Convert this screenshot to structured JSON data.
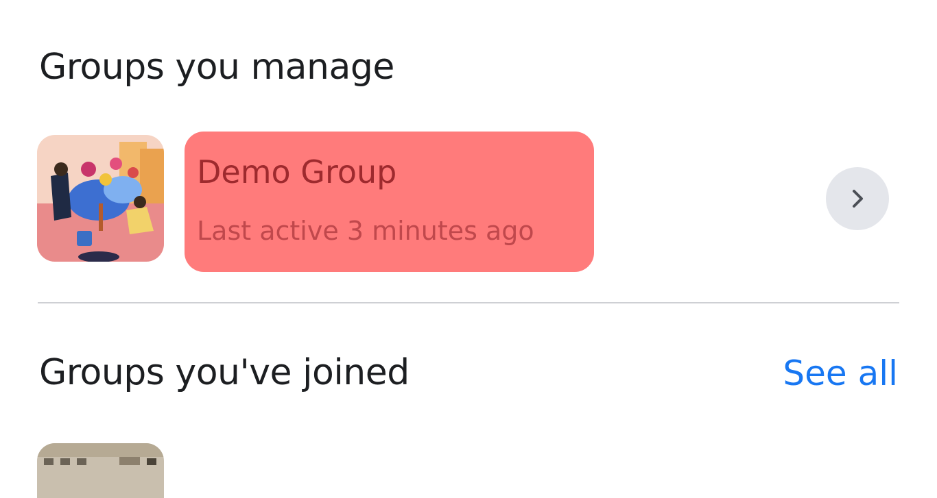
{
  "sections": {
    "manage": {
      "title": "Groups you manage",
      "groups": [
        {
          "name": "Demo Group",
          "last_active": "Last active 3 minutes ago",
          "thumbnail": "group-illustration-flowers"
        }
      ]
    },
    "joined": {
      "title": "Groups you've joined",
      "see_all_label": "See all",
      "thumbnail": "group-photo-partial"
    }
  },
  "icons": {
    "open_group": "chevron-right-icon"
  },
  "colors": {
    "highlight": "#ff7b7b",
    "link": "#1877f2",
    "chevron_bg": "#e4e6eb",
    "divider": "#ced0d4"
  }
}
